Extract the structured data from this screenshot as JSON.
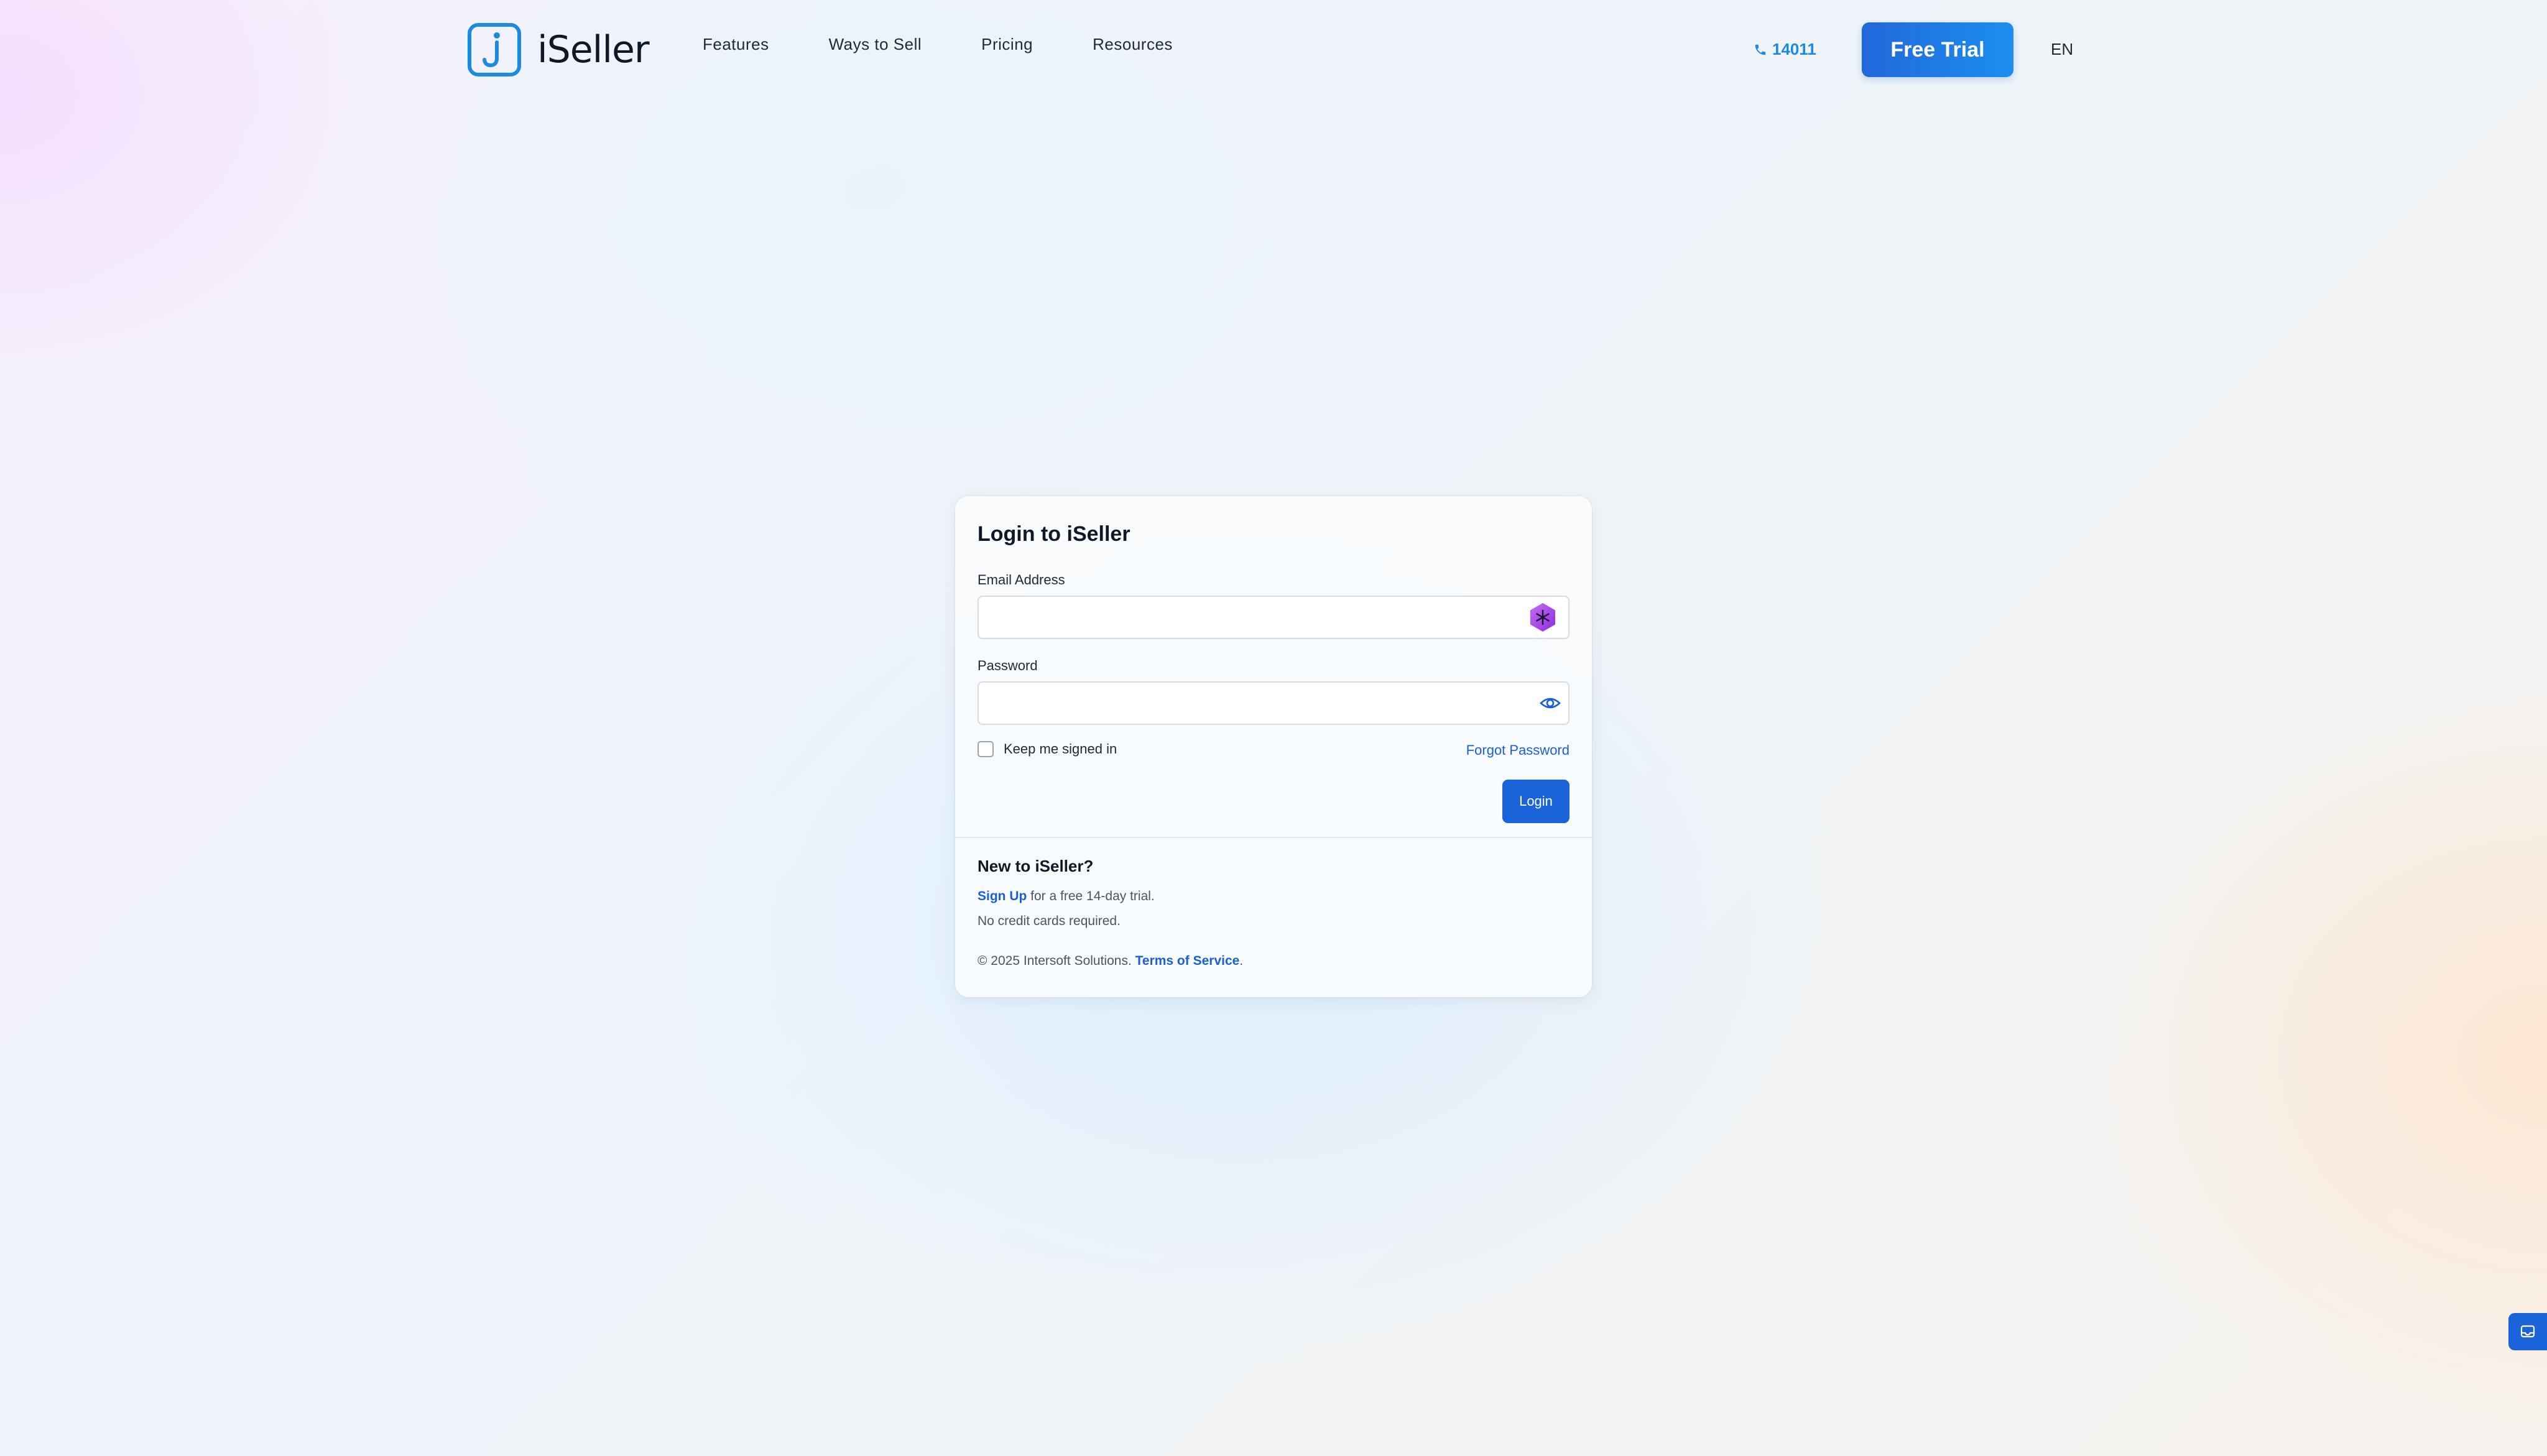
{
  "brand": {
    "name": "iSeller",
    "accent_color": "#1b8be0",
    "logo_icon": "iseller-logo-icon"
  },
  "nav": {
    "items": [
      {
        "label": "Features"
      },
      {
        "label": "Ways to Sell"
      },
      {
        "label": "Pricing"
      },
      {
        "label": "Resources"
      }
    ]
  },
  "header": {
    "phone_icon": "phone-icon",
    "phone": "14011",
    "cta_label": "Free Trial",
    "language": "EN"
  },
  "login": {
    "title": "Login to iSeller",
    "email_label": "Email Address",
    "email_value": "",
    "email_icon": "password-manager-hex-icon",
    "password_label": "Password",
    "password_value": "",
    "password_icon": "eye-icon",
    "keep_signed_in_label": "Keep me signed in",
    "keep_signed_in_checked": false,
    "forgot_label": "Forgot Password",
    "submit_label": "Login",
    "submit_color": "#1b63d8"
  },
  "signup": {
    "title": "New to iSeller?",
    "link_label": "Sign Up",
    "trial_text": " for a free 14-day trial.",
    "no_card_text": "No credit cards required."
  },
  "footer": {
    "copyright": "© 2025 Intersoft Solutions. ",
    "terms_label": "Terms of Service",
    "terms_suffix": "."
  },
  "widget": {
    "icon": "chat-inbox-icon"
  }
}
